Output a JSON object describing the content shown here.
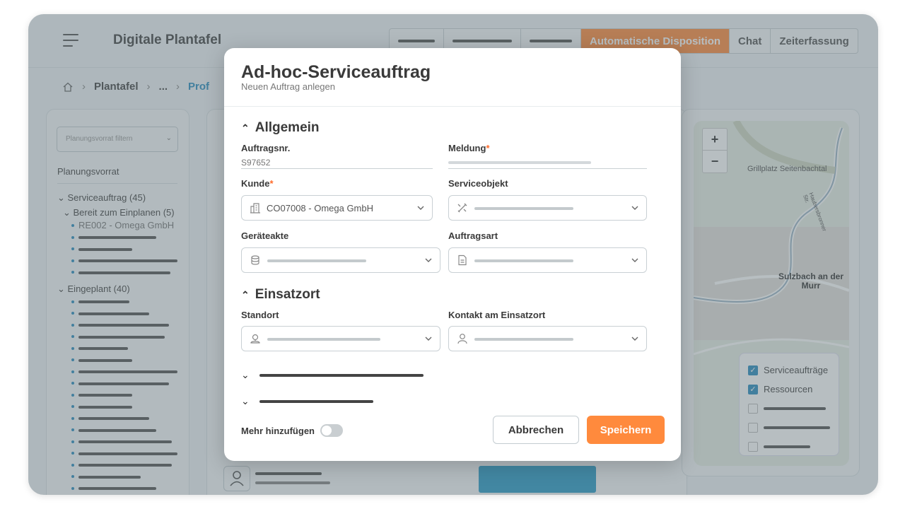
{
  "app": {
    "title": "Digitale Plantafel",
    "nav": {
      "active_label": "Automatische Disposition",
      "chat_label": "Chat",
      "time_label": "Zeiterfassung"
    }
  },
  "breadcrumb": {
    "plantafel": "Plantafel",
    "ellipsis": "...",
    "current": "Prof"
  },
  "left_panel": {
    "filter_placeholder": "Planungsvorrat filtern",
    "title": "Planungsvorrat",
    "group1": "Serviceauftrag (45)",
    "group1_sub": "Bereit zum Einplanen (5)",
    "first_item": "RE002 - Omega GmbH",
    "group2": "Eingeplant (40)"
  },
  "map": {
    "place1": "Grillplatz Seitenbachtal",
    "city": "Sulzbach an der Murr",
    "road1": "Haubersbronner Str.",
    "legend": {
      "item1": "Serviceaufträge",
      "item2": "Ressourcen"
    }
  },
  "modal": {
    "title": "Ad-hoc-Serviceauftrag",
    "subtitle": "Neuen Auftrag anlegen",
    "section_general": "Allgemein",
    "order_no_label": "Auftragsnr.",
    "order_no_value": "S97652",
    "message_label": "Meldung",
    "required_mark": "*",
    "customer_label": "Kunde",
    "customer_value": "CO07008 - Omega GmbH",
    "service_object_label": "Serviceobjekt",
    "device_file_label": "Geräteakte",
    "order_type_label": "Auftragsart",
    "section_location": "Einsatzort",
    "location_label": "Standort",
    "contact_label": "Kontakt am Einsatzort",
    "add_more_label": "Mehr hinzufügen",
    "cancel_label": "Abbrechen",
    "save_label": "Speichern"
  },
  "colors": {
    "accent": "#ff8a3d",
    "link": "#2a8dbf",
    "required": "#ff6a2a"
  }
}
